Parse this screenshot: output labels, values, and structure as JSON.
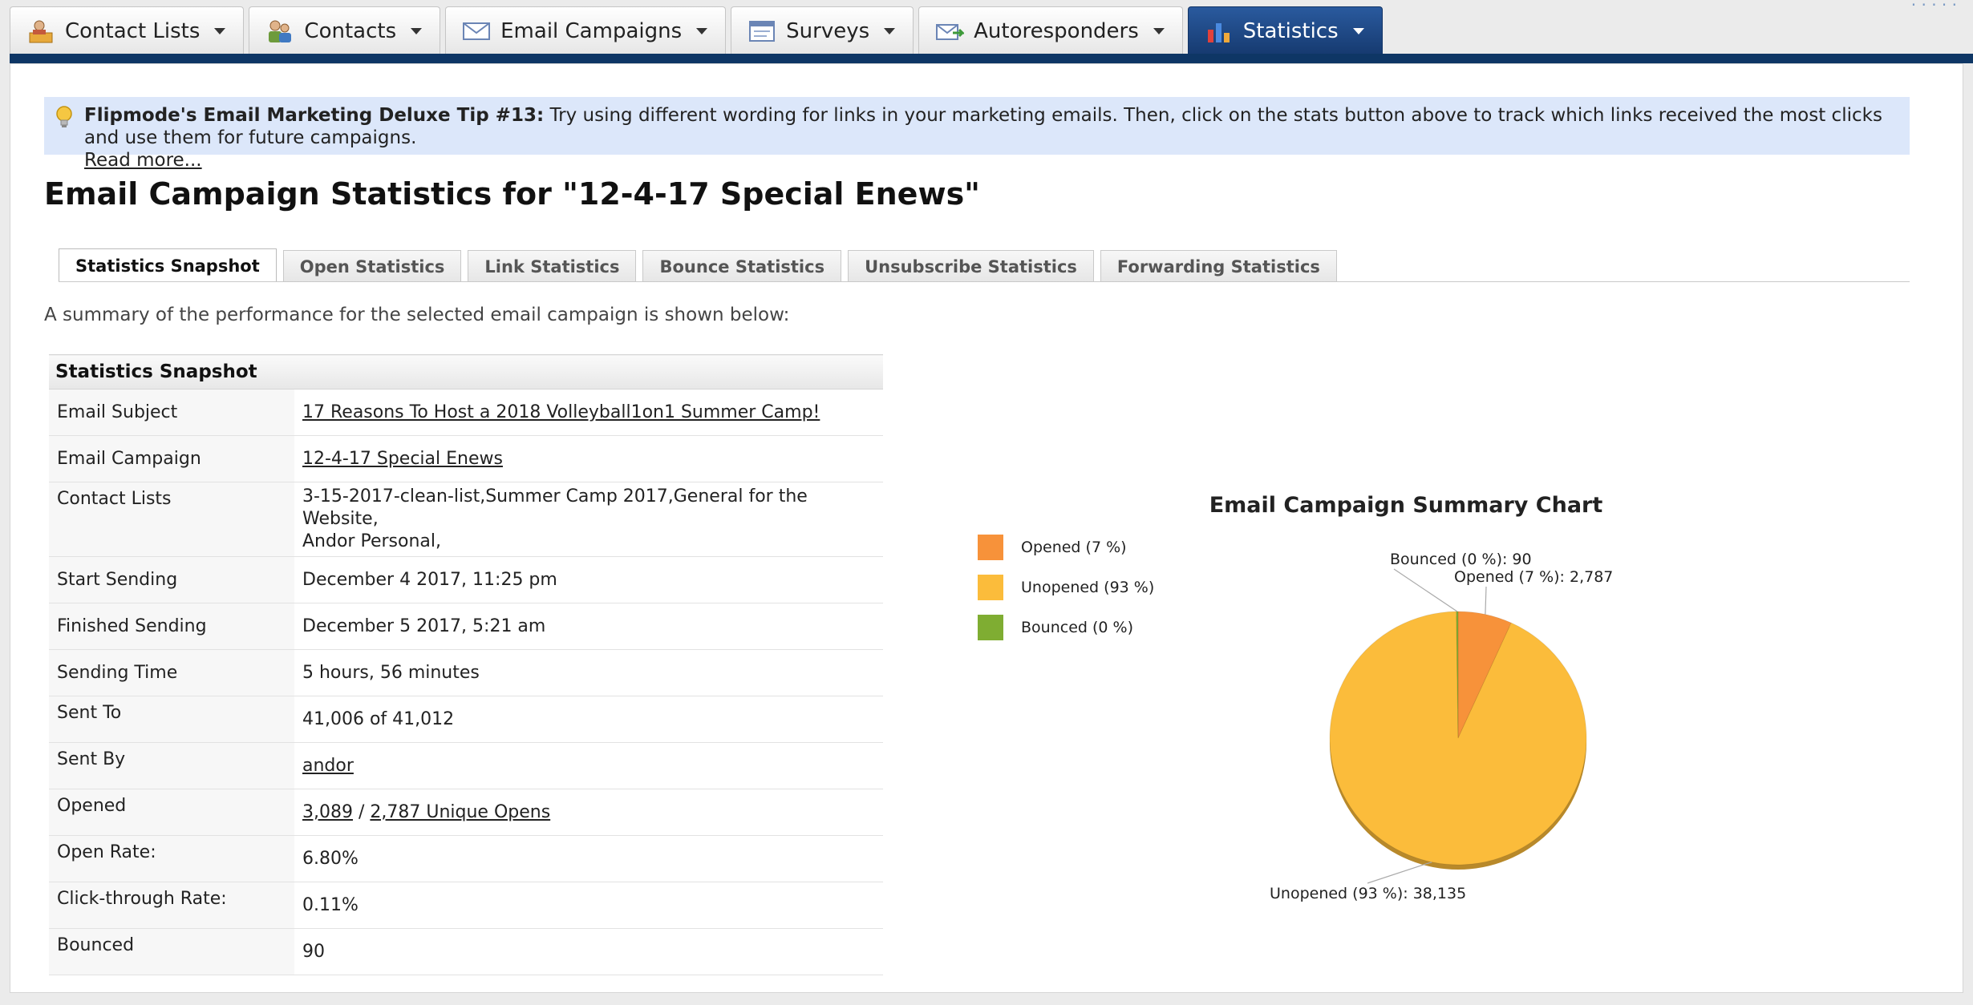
{
  "nav": {
    "tabs": [
      {
        "label": "Contact Lists",
        "icon": "contact-lists-icon"
      },
      {
        "label": "Contacts",
        "icon": "contacts-icon"
      },
      {
        "label": "Email Campaigns",
        "icon": "envelope-icon"
      },
      {
        "label": "Surveys",
        "icon": "survey-icon"
      },
      {
        "label": "Autoresponders",
        "icon": "autoresponder-icon"
      },
      {
        "label": "Statistics",
        "icon": "bar-chart-icon",
        "active": true
      }
    ]
  },
  "tip": {
    "title": "Flipmode's Email Marketing Deluxe Tip #13:",
    "text": " Try using different wording for links in your marketing emails. Then, click on the stats button above to track which links received the most clicks and use them for future campaigns.",
    "read_more": "Read more..."
  },
  "page_title": "Email Campaign Statistics for \"12-4-17 Special Enews\"",
  "subtabs": [
    {
      "label": "Statistics Snapshot",
      "active": true
    },
    {
      "label": "Open Statistics"
    },
    {
      "label": "Link Statistics"
    },
    {
      "label": "Bounce Statistics"
    },
    {
      "label": "Unsubscribe Statistics"
    },
    {
      "label": "Forwarding Statistics"
    }
  ],
  "summary_text": "A summary of the performance for the selected email campaign is shown below:",
  "snapshot": {
    "heading": "Statistics Snapshot",
    "rows": [
      {
        "label": "Email Subject",
        "value": "17 Reasons To Host a 2018 Volleyball1on1 Summer Camp!"
      },
      {
        "label": "Email Campaign",
        "value": "12-4-17 Special Enews"
      },
      {
        "label": "Contact Lists",
        "value_line1": "3-15-2017-clean-list,Summer Camp 2017,General for the Website,",
        "value_line2": "Andor Personal,"
      },
      {
        "label": "Start Sending",
        "value": "December 4 2017, 11:25 pm"
      },
      {
        "label": "Finished Sending",
        "value": "December 5 2017, 5:21 am"
      },
      {
        "label": "Sending Time",
        "value": "5 hours, 56 minutes"
      },
      {
        "label": "Sent To",
        "value": "41,006 of 41,012"
      },
      {
        "label": "Sent By",
        "value": "andor"
      },
      {
        "label": "Opened",
        "opens": "3,089",
        "separator": " / ",
        "unique_opens": "2,787 Unique Opens"
      },
      {
        "label": "Open Rate:",
        "value": "6.80%"
      },
      {
        "label": "Click-through Rate:",
        "value": "0.11%"
      },
      {
        "label": "Bounced",
        "value": "90"
      }
    ]
  },
  "chart_data": {
    "type": "pie",
    "title": "Email Campaign Summary Chart",
    "categories": [
      "Opened",
      "Unopened",
      "Bounced"
    ],
    "values": [
      2787,
      38135,
      90
    ],
    "percent_labels": [
      "7 %",
      "93 %",
      "0 %"
    ],
    "legend": [
      "Opened (7 %)",
      "Unopened (93 %)",
      "Bounced (0 %)"
    ],
    "slice_labels": [
      "Opened (7 %): 2,787",
      "Unopened (93 %): 38,135",
      "Bounced (0 %): 90"
    ],
    "colors": [
      "#f7923a",
      "#fbbc3b",
      "#7fad32"
    ],
    "legend_placement": "left"
  }
}
